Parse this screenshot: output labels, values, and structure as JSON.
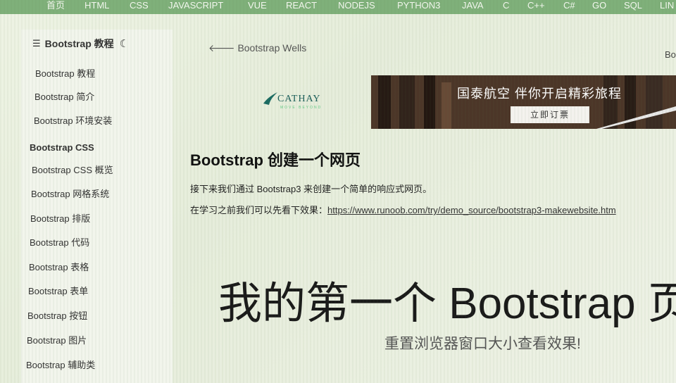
{
  "topnav": {
    "items": [
      "首页",
      "HTML",
      "CSS",
      "JAVASCRIPT",
      "VUE",
      "REACT",
      "NODEJS",
      "PYTHON3",
      "JAVA",
      "C",
      "C++",
      "C#",
      "GO",
      "SQL",
      "LIN"
    ]
  },
  "sidebar": {
    "title": "Bootstrap 教程",
    "links_top": [
      "Bootstrap 教程",
      "Bootstrap 简介",
      "Bootstrap 环境安装"
    ],
    "group_css": "Bootstrap CSS",
    "links_css": [
      "Bootstrap CSS 概览",
      "Bootstrap 网格系统",
      "Bootstrap 排版",
      "Bootstrap 代码",
      "Bootstrap 表格",
      "Bootstrap 表单",
      "Bootstrap 按钮",
      "Bootstrap 图片",
      "Bootstrap 辅助类"
    ]
  },
  "main": {
    "back_link": "Bootstrap Wells",
    "right_partial": "Bo",
    "ad": {
      "brand": "CATHAY",
      "tagline": "MOVE BEYOND",
      "slogan": "国泰航空 伴你开启精彩旅程",
      "cta": "立即订票"
    },
    "heading": "Bootstrap 创建一个网页",
    "para1": "接下来我们通过 Bootstrap3 来创建一个简单的响应式网页。",
    "para2_prefix": "在学习之前我们可以先看下效果：",
    "para2_link": "https://www.runoob.com/try/demo_source/bootstrap3-makewebsite.htm",
    "demo_title": "我的第一个 Bootstrap 页",
    "demo_subtitle": "重置浏览器窗口大小查看效果!"
  }
}
